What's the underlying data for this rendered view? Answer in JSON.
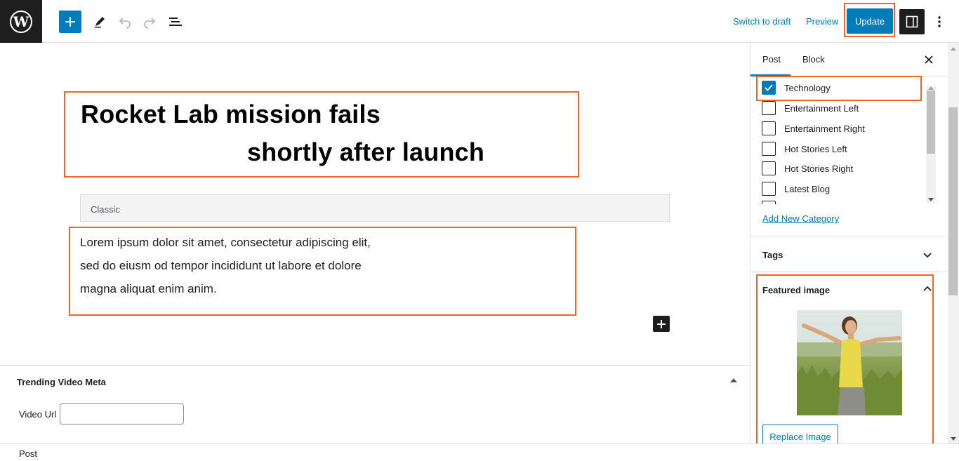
{
  "toolbar": {
    "logo_icon": "wordpress-logo-icon",
    "logo_letter": "W",
    "switch_to_draft": "Switch to draft",
    "preview": "Preview",
    "update": "Update"
  },
  "editor": {
    "title_line1": "Rocket Lab mission fails",
    "title_line2": "shortly after launch",
    "classic_label": "Classic",
    "body_text": "Lorem ipsum dolor sit amet, consectetur adipiscing elit, sed do eiusm od tempor incididunt ut labore et dolore magna aliquat enim anim."
  },
  "meta_box": {
    "title": "Trending Video Meta",
    "video_url_label": "Video Url",
    "video_url_value": ""
  },
  "footer": {
    "breadcrumb": "Post"
  },
  "sidebar": {
    "tabs": [
      {
        "label": "Post",
        "active": true
      },
      {
        "label": "Block",
        "active": false
      }
    ],
    "categories": [
      {
        "label": "Technology",
        "checked": true
      },
      {
        "label": "Entertainment Left",
        "checked": false
      },
      {
        "label": "Entertainment Right",
        "checked": false
      },
      {
        "label": "Hot Stories Left",
        "checked": false
      },
      {
        "label": "Hot Stories Right",
        "checked": false
      },
      {
        "label": "Latest Blog",
        "checked": false
      }
    ],
    "add_new_category": "Add New Category",
    "tags_title": "Tags",
    "featured_image_title": "Featured image",
    "replace_image": "Replace Image"
  },
  "colors": {
    "accent": "#007cba",
    "highlight": "#f26522",
    "dark": "#1e1e1e"
  }
}
